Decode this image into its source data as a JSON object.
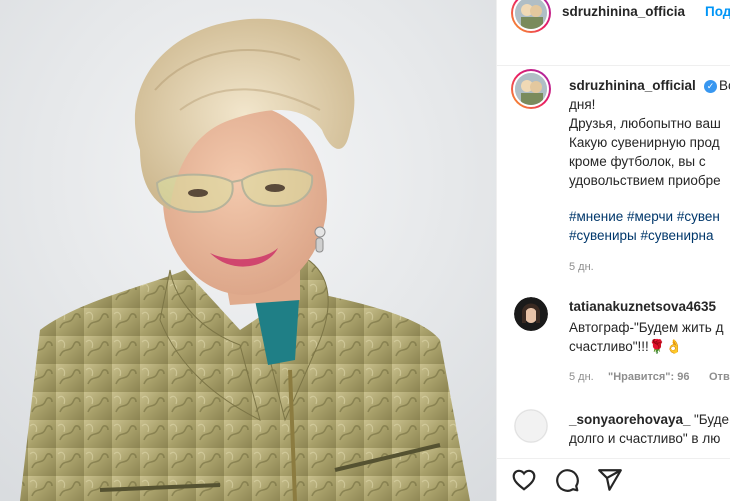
{
  "post": {
    "username": "sdruzhinina_officia",
    "follow_label": "Подп",
    "image_alt": "Portrait photo"
  },
  "caption": {
    "username": "sdruzhinina_official",
    "first_words": "Во",
    "lines": [
      "дня!",
      "Друзья, любопытно ваш",
      "Какую сувенирную прод",
      "кроме футболок, вы с",
      "удовольствием приобре"
    ],
    "hashtags": [
      "#мнение #мерчи #сувен",
      "#сувениры #сувенирна"
    ],
    "time": "5 дн."
  },
  "comments": [
    {
      "username": "tatianakuznetsova4635",
      "lines": [
        "Автограф-\"Будем жить д",
        "счастливо\"!!!🌹👌"
      ],
      "time": "5 дн.",
      "likes": "\"Нравится\": 96",
      "reply": "Отв"
    },
    {
      "username": "_sonyaorehovaya_",
      "first_words": "\"Буде",
      "lines": [
        "долго и счастливо\" в лю"
      ]
    }
  ],
  "icons": {
    "like": "heart-icon",
    "comment": "comment-icon",
    "share": "share-icon"
  },
  "colors": {
    "link_blue": "#0095f6",
    "hashtag": "#00376b",
    "muted": "#8e8e8e",
    "verified": "#3897f0"
  }
}
